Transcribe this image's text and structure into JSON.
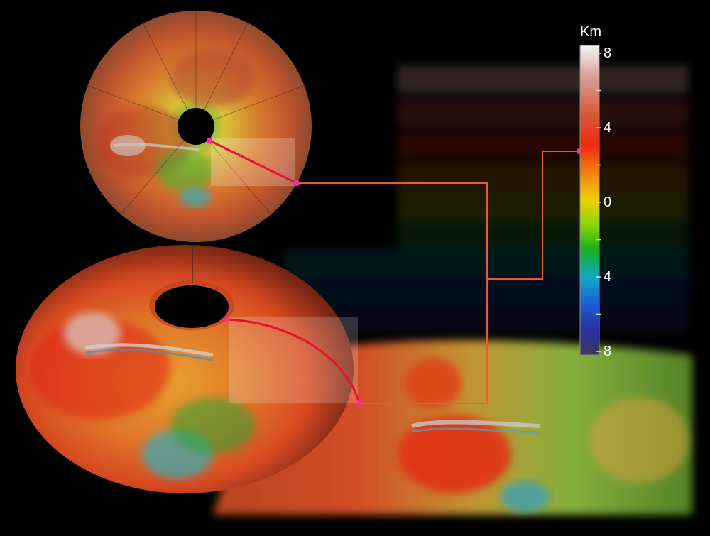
{
  "figure": {
    "description_free": true,
    "scale": {
      "unit": "Km",
      "ticks": [
        {
          "label": "8",
          "value": 8
        },
        {
          "label": "4",
          "value": 4
        },
        {
          "label": "0",
          "value": 0
        },
        {
          "label": "4",
          "value": -4
        },
        {
          "label": "8",
          "value": -8
        }
      ],
      "colors": [
        "#f4f4f4",
        "#d9a09a",
        "#d85a3a",
        "#ee2a10",
        "#f08a10",
        "#f2d000",
        "#8ad400",
        "#18b020",
        "#10a8c8",
        "#1a62d8",
        "#2a2fa0",
        "#3a3a5a"
      ]
    },
    "connector_color": "#f05a28",
    "marker_color": "#ff2aa0"
  }
}
